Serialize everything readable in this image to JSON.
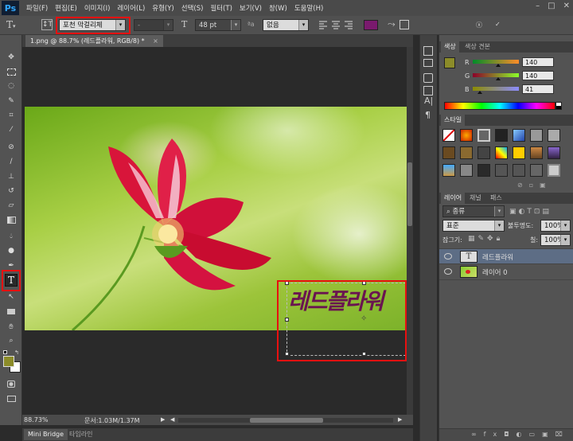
{
  "app": {
    "logo": "Ps"
  },
  "menubar": {
    "items": [
      "파일(F)",
      "편집(E)",
      "이미지(I)",
      "레이어(L)",
      "유형(Y)",
      "선택(S)",
      "필터(T)",
      "보기(V)",
      "창(W)",
      "도움말(H)"
    ],
    "window_controls": [
      "–",
      "□",
      "✕"
    ]
  },
  "options": {
    "font_family": "포천 막걸리체",
    "font_style": "-",
    "font_size": "48 pt",
    "aa_icon_label": "ªa",
    "antialias": "없음",
    "text_color": "#7a1a6e"
  },
  "document": {
    "tab_title": "1.png @ 88.7% (레드플라워, RGB/8) *",
    "canvas_text": "레드플라워",
    "canvas_text_color": "#6a1450"
  },
  "statusbar": {
    "zoom": "88.73%",
    "doc_info": "문서:1.03M/1.37M"
  },
  "bottom_tabs": [
    "Mini Bridge",
    "타임라인"
  ],
  "color_panel": {
    "tabs": [
      "색상",
      "색상 견본"
    ],
    "r": {
      "label": "R",
      "value": 140
    },
    "g": {
      "label": "G",
      "value": 140
    },
    "b": {
      "label": "B",
      "value": 41
    },
    "foreground": "#8c8c29"
  },
  "styles_panel": {
    "tabs": [
      "스타일"
    ]
  },
  "layers_panel": {
    "tabs": [
      "레이어",
      "채널",
      "패스"
    ],
    "filter_kind": "종류",
    "blend_mode": "표준",
    "opacity_label": "불투명도:",
    "opacity_value": "100%",
    "lock_label": "잠그기:",
    "fill_label": "칠:",
    "fill_value": "100%",
    "layers": [
      {
        "name": "레드플라워",
        "type": "text",
        "selected": true
      },
      {
        "name": "레이어 0",
        "type": "image",
        "selected": false
      }
    ]
  }
}
